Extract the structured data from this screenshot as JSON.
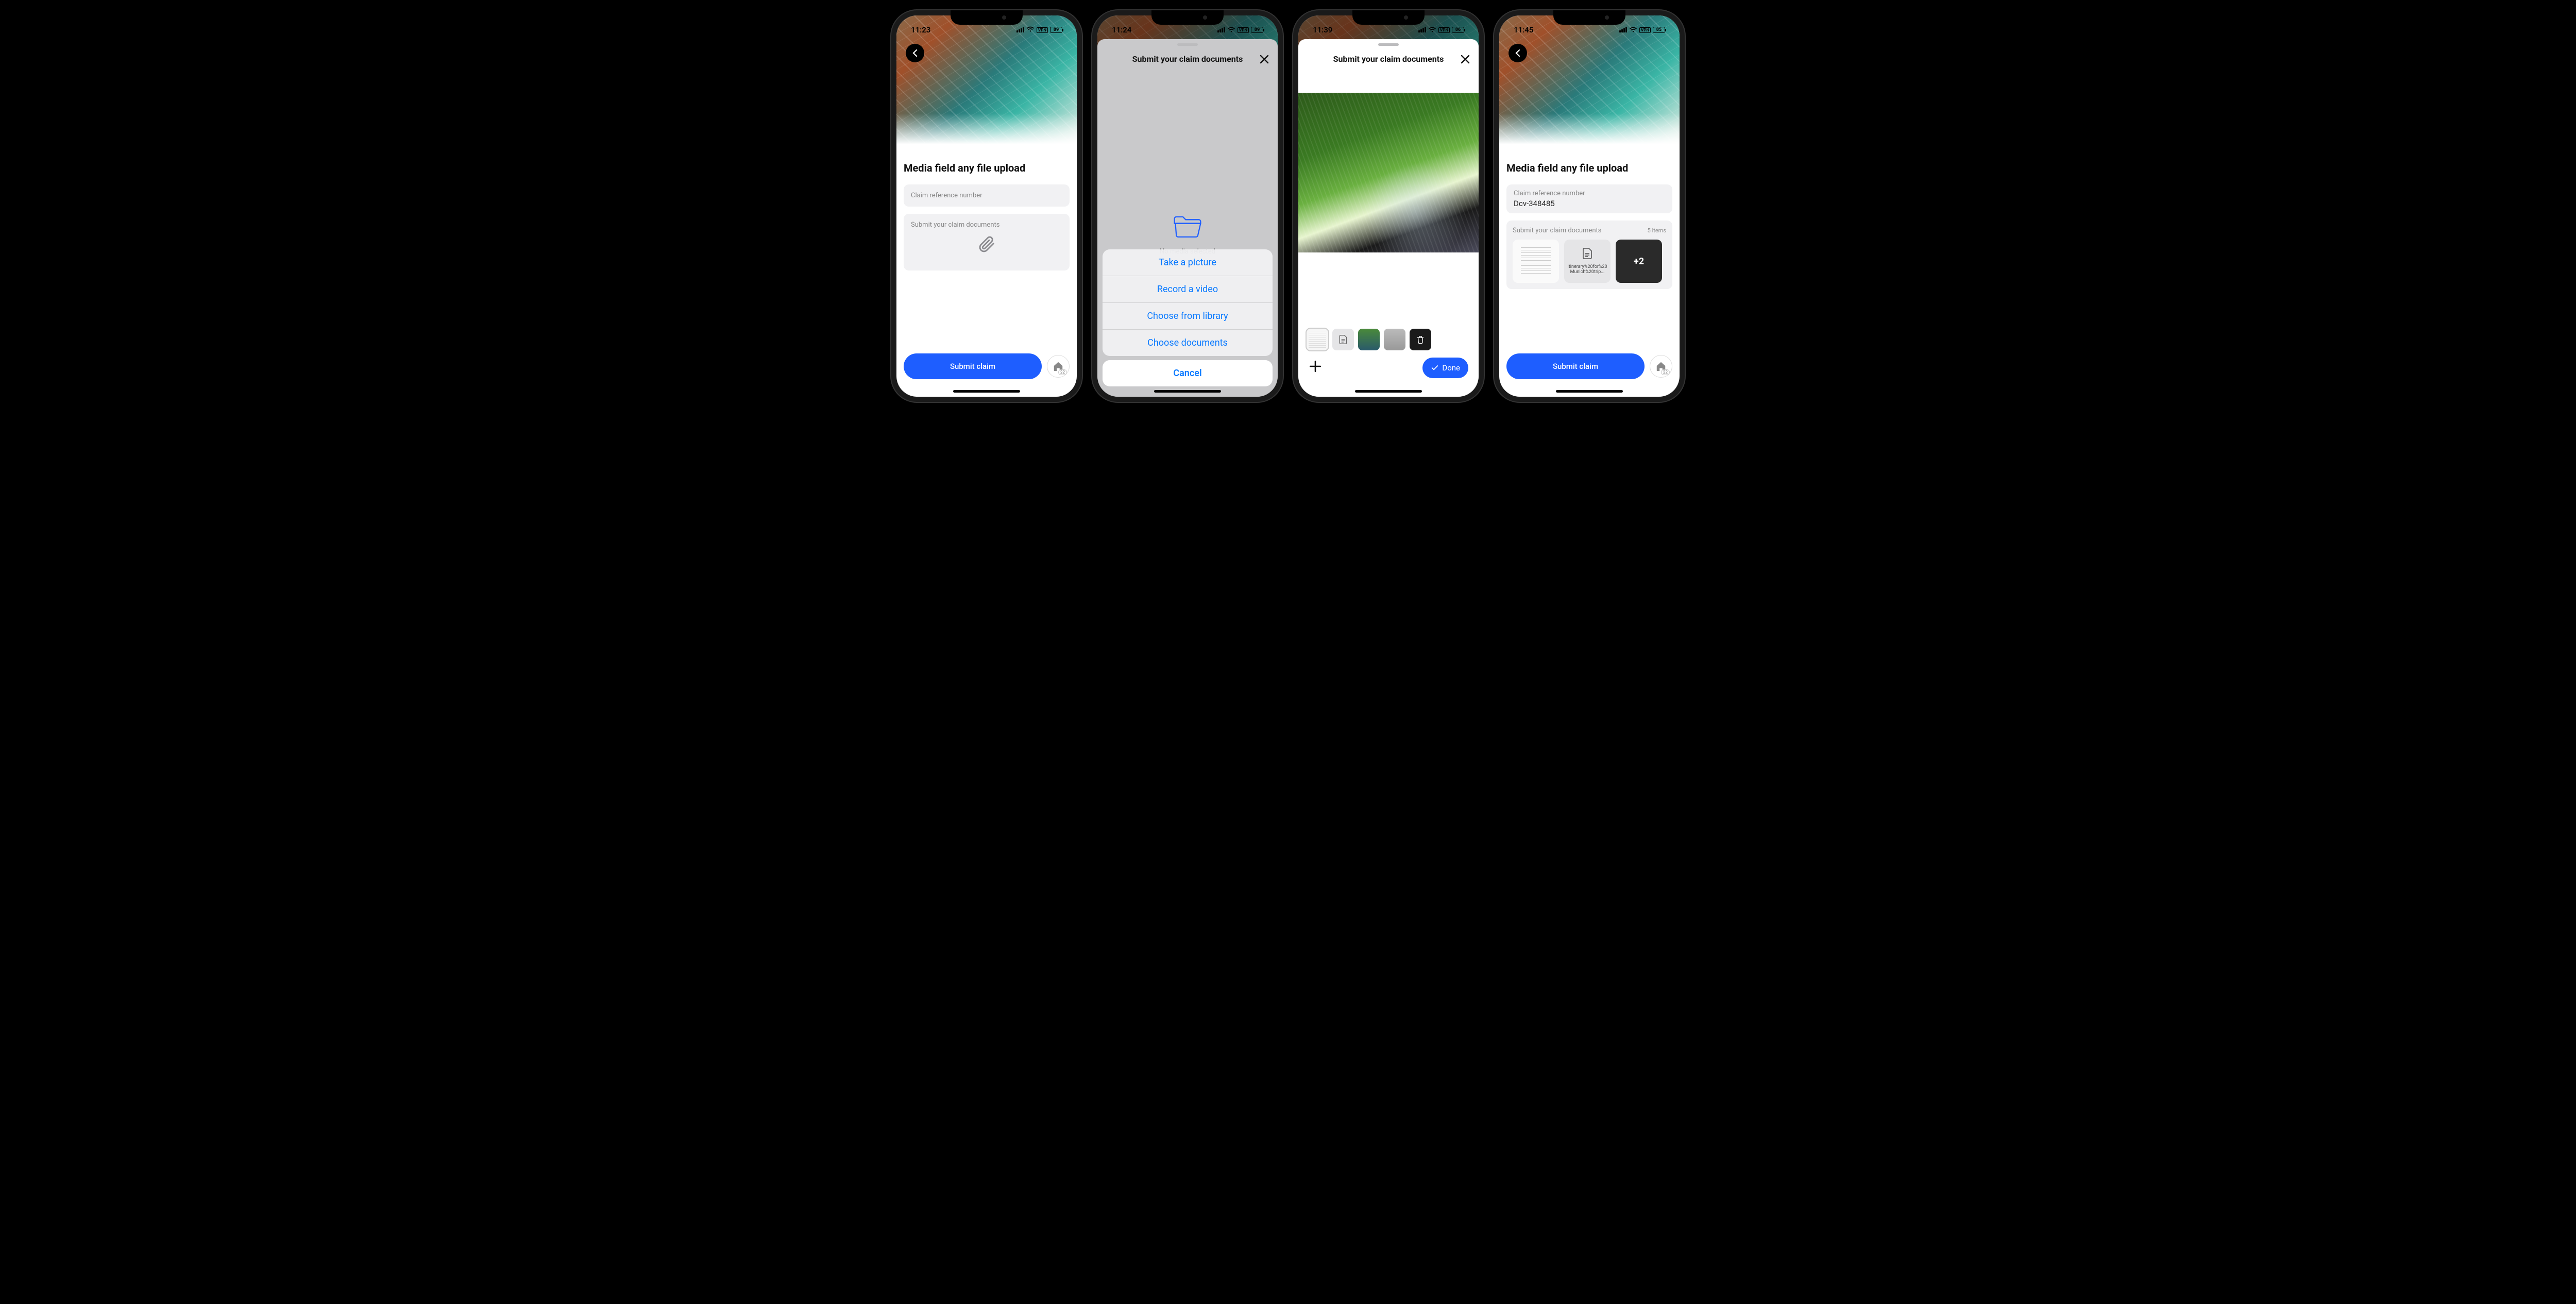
{
  "phone1": {
    "status": {
      "time": "11:23",
      "wifi": "▲",
      "battery": "89"
    },
    "page_title": "Media field any file upload",
    "claim_field": {
      "placeholder": "Claim reference number",
      "value": ""
    },
    "docs_field": {
      "label": "Submit your claim documents"
    },
    "submit_label": "Submit claim",
    "home_badge": "22"
  },
  "phone2": {
    "status": {
      "time": "11:24",
      "battery": "89"
    },
    "sheet_title": "Submit your claim documents",
    "no_media": "No media selected",
    "actions": {
      "take_picture": "Take a picture",
      "record_video": "Record a video",
      "choose_library": "Choose from library",
      "choose_documents": "Choose documents",
      "cancel": "Cancel"
    }
  },
  "phone3": {
    "status": {
      "time": "11:39",
      "battery": "86"
    },
    "sheet_title": "Submit your claim documents",
    "thumbs": [
      {
        "kind": "doc"
      },
      {
        "kind": "file-icon"
      },
      {
        "kind": "photo-green"
      },
      {
        "kind": "photo-gray"
      },
      {
        "kind": "trash"
      }
    ],
    "done_label": "Done"
  },
  "phone4": {
    "status": {
      "time": "11:45",
      "battery": "85"
    },
    "page_title": "Media field any file upload",
    "claim_field": {
      "placeholder": "Claim reference number",
      "value": "Dcv-348485"
    },
    "docs_field": {
      "label": "Submit your claim documents",
      "count_label": "5 items"
    },
    "thumbs": [
      {
        "kind": "docimg"
      },
      {
        "kind": "file",
        "filename": "Itinerary%20for%20Munich%20trip..."
      },
      {
        "kind": "more",
        "label": "+2"
      }
    ],
    "submit_label": "Submit claim",
    "home_badge": "22"
  }
}
